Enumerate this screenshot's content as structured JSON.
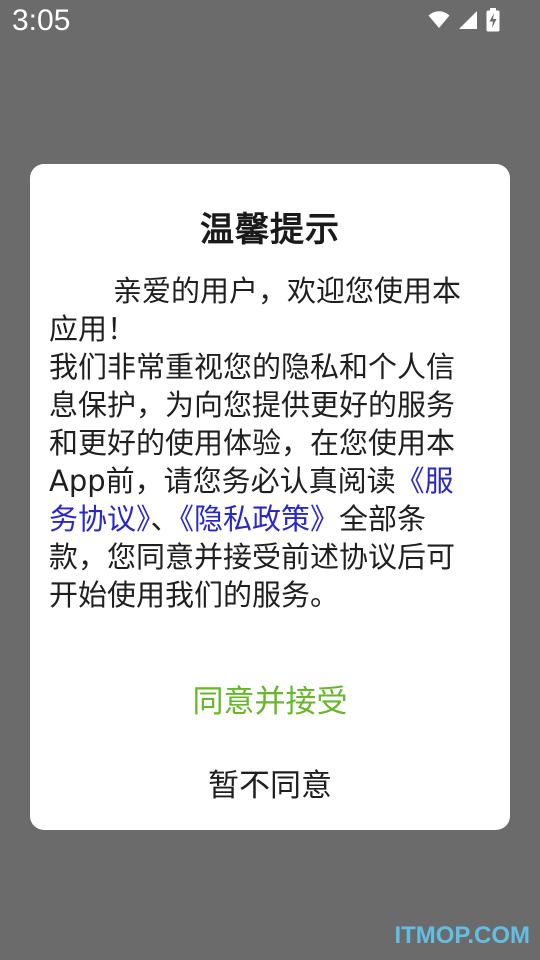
{
  "status_bar": {
    "time": "3:05",
    "icons": [
      "wifi-icon",
      "cellular-signal-icon",
      "battery-charging-icon"
    ]
  },
  "dialog": {
    "title": "温馨提示",
    "greeting": "亲爱的用户，欢迎您使用本应用！",
    "body_part1": "我们非常重视您的隐私和个人信息保护，为向您提供更好的服务和更好的使用体验，在您使用本App前，请您务必认真阅读",
    "service_agreement_link": "《服务协议》",
    "separator": "、",
    "privacy_policy_link": "《隐私政策》",
    "body_part2": "全部条款，您同意并接受前述协议后可开始使用我们的服务。",
    "agree_label": "同意并接受",
    "disagree_label": "暂不同意"
  },
  "watermark": "ITMOP.COM",
  "colors": {
    "overlay": "#6b6b6b",
    "dialog_bg": "#ffffff",
    "link": "#2a27c9",
    "agree": "#66b72a",
    "text": "#1f1f1f"
  }
}
